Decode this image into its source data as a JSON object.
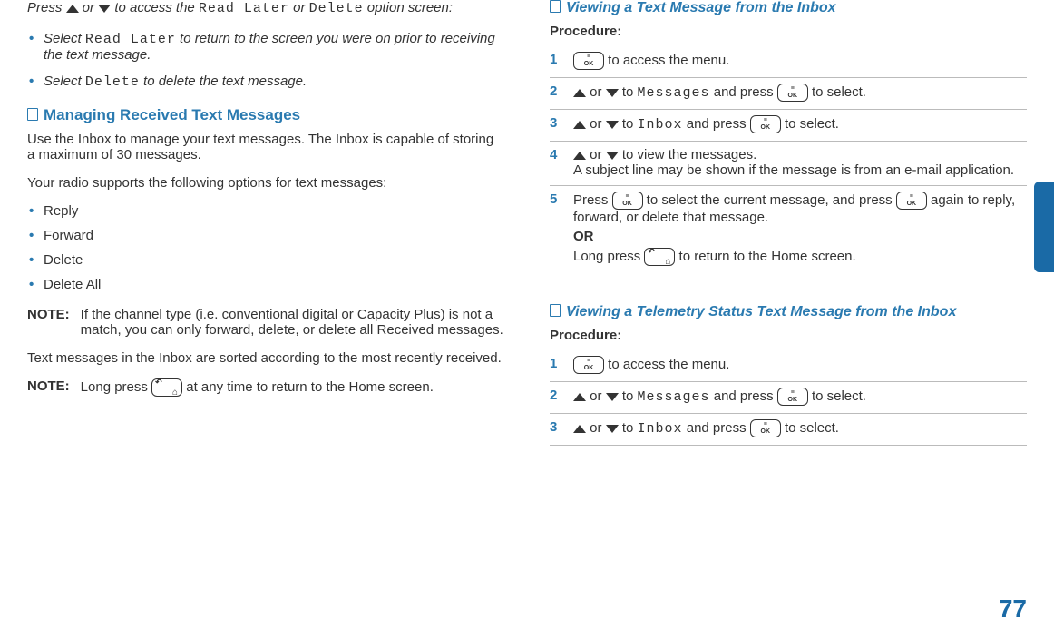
{
  "left": {
    "intro_parts": {
      "p1": "Press ",
      "p2": " or ",
      "p3": " to access the ",
      "read_later": "Read Later",
      "p4": " or ",
      "delete": "Delete",
      "p5": " option screen:"
    },
    "option_bullets": {
      "b1a": "Select ",
      "b1_mono": "Read Later",
      "b1b": " to return to the screen you were on prior to receiving the text message.",
      "b2a": "Select ",
      "b2_mono": "Delete",
      "b2b": " to delete the text message."
    },
    "section_title": "Managing Received Text Messages",
    "para1": "Use the Inbox to manage your text messages. The Inbox is capable of storing a maximum of 30 messages.",
    "para2": "Your radio supports the following options for text messages:",
    "options": [
      "Reply",
      "Forward",
      "Delete",
      "Delete All"
    ],
    "note1_label": "NOTE:",
    "note1_text": "If the channel type (i.e. conventional digital or Capacity Plus) is not a match, you can only forward, delete, or delete all Received messages.",
    "para3": "Text messages in the Inbox are sorted according to the most recently received.",
    "note2_label": "NOTE:",
    "note2a": "Long press ",
    "note2b": " at any time to return to the Home screen."
  },
  "right": {
    "section1_title": "Viewing a Text Message from the Inbox",
    "procedure_label": "Procedure:",
    "s1a": " to access the menu.",
    "s2a": " or ",
    "s2b": " to ",
    "s2_mono": "Messages",
    "s2c": " and press ",
    "s2d": " to select.",
    "s3a": " or ",
    "s3b": " to ",
    "s3_mono": "Inbox",
    "s3c": " and press ",
    "s3d": " to select.",
    "s4a": " or ",
    "s4b": " to view the messages.",
    "s4_sub": "A subject line may be shown if the message is from an e-mail application.",
    "s5a": "Press ",
    "s5b": " to select the current message, and press ",
    "s5c": " again to reply, forward, or delete that message.",
    "s5_or": "OR",
    "s5d": "Long press ",
    "s5e": " to return to the Home screen.",
    "section2_title": "Viewing a Telemetry Status Text Message from the Inbox",
    "procedure_label2": "Procedure:",
    "t1a": " to access the menu.",
    "t2a": " or ",
    "t2b": " to ",
    "t2_mono": "Messages",
    "t2c": " and press ",
    "t2d": " to select.",
    "t3a": " or ",
    "t3b": " to ",
    "t3_mono": "Inbox",
    "t3c": " and press ",
    "t3d": " to select."
  },
  "page_number": "77"
}
